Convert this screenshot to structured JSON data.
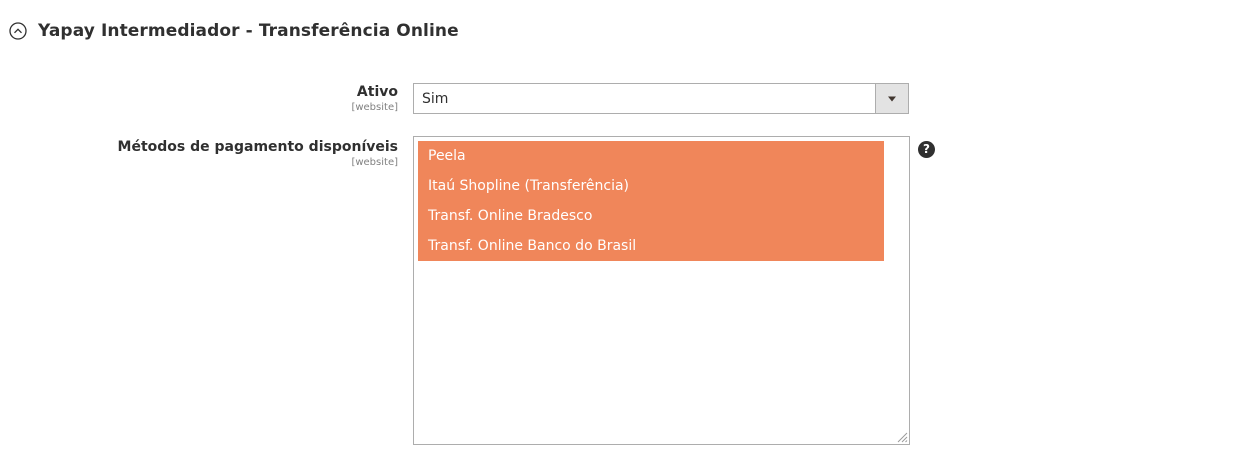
{
  "section": {
    "title": "Yapay Intermediador - Transferência Online",
    "icon": "chevron-up-circle-icon"
  },
  "fields": {
    "ativo": {
      "label": "Ativo",
      "scope": "[website]",
      "value": "Sim"
    },
    "metodos": {
      "label": "Métodos de pagamento disponíveis",
      "scope": "[website]",
      "options": [
        "Peela",
        "Itaú Shopline (Transferência)",
        "Transf. Online Bradesco",
        "Transf. Online Banco do Brasil"
      ],
      "help_icon": "question-circle-icon",
      "help_glyph": "?"
    }
  },
  "colors": {
    "selected_option": "#f0865a",
    "text": "#303030",
    "border": "#adadad",
    "scope_text": "#808080"
  }
}
